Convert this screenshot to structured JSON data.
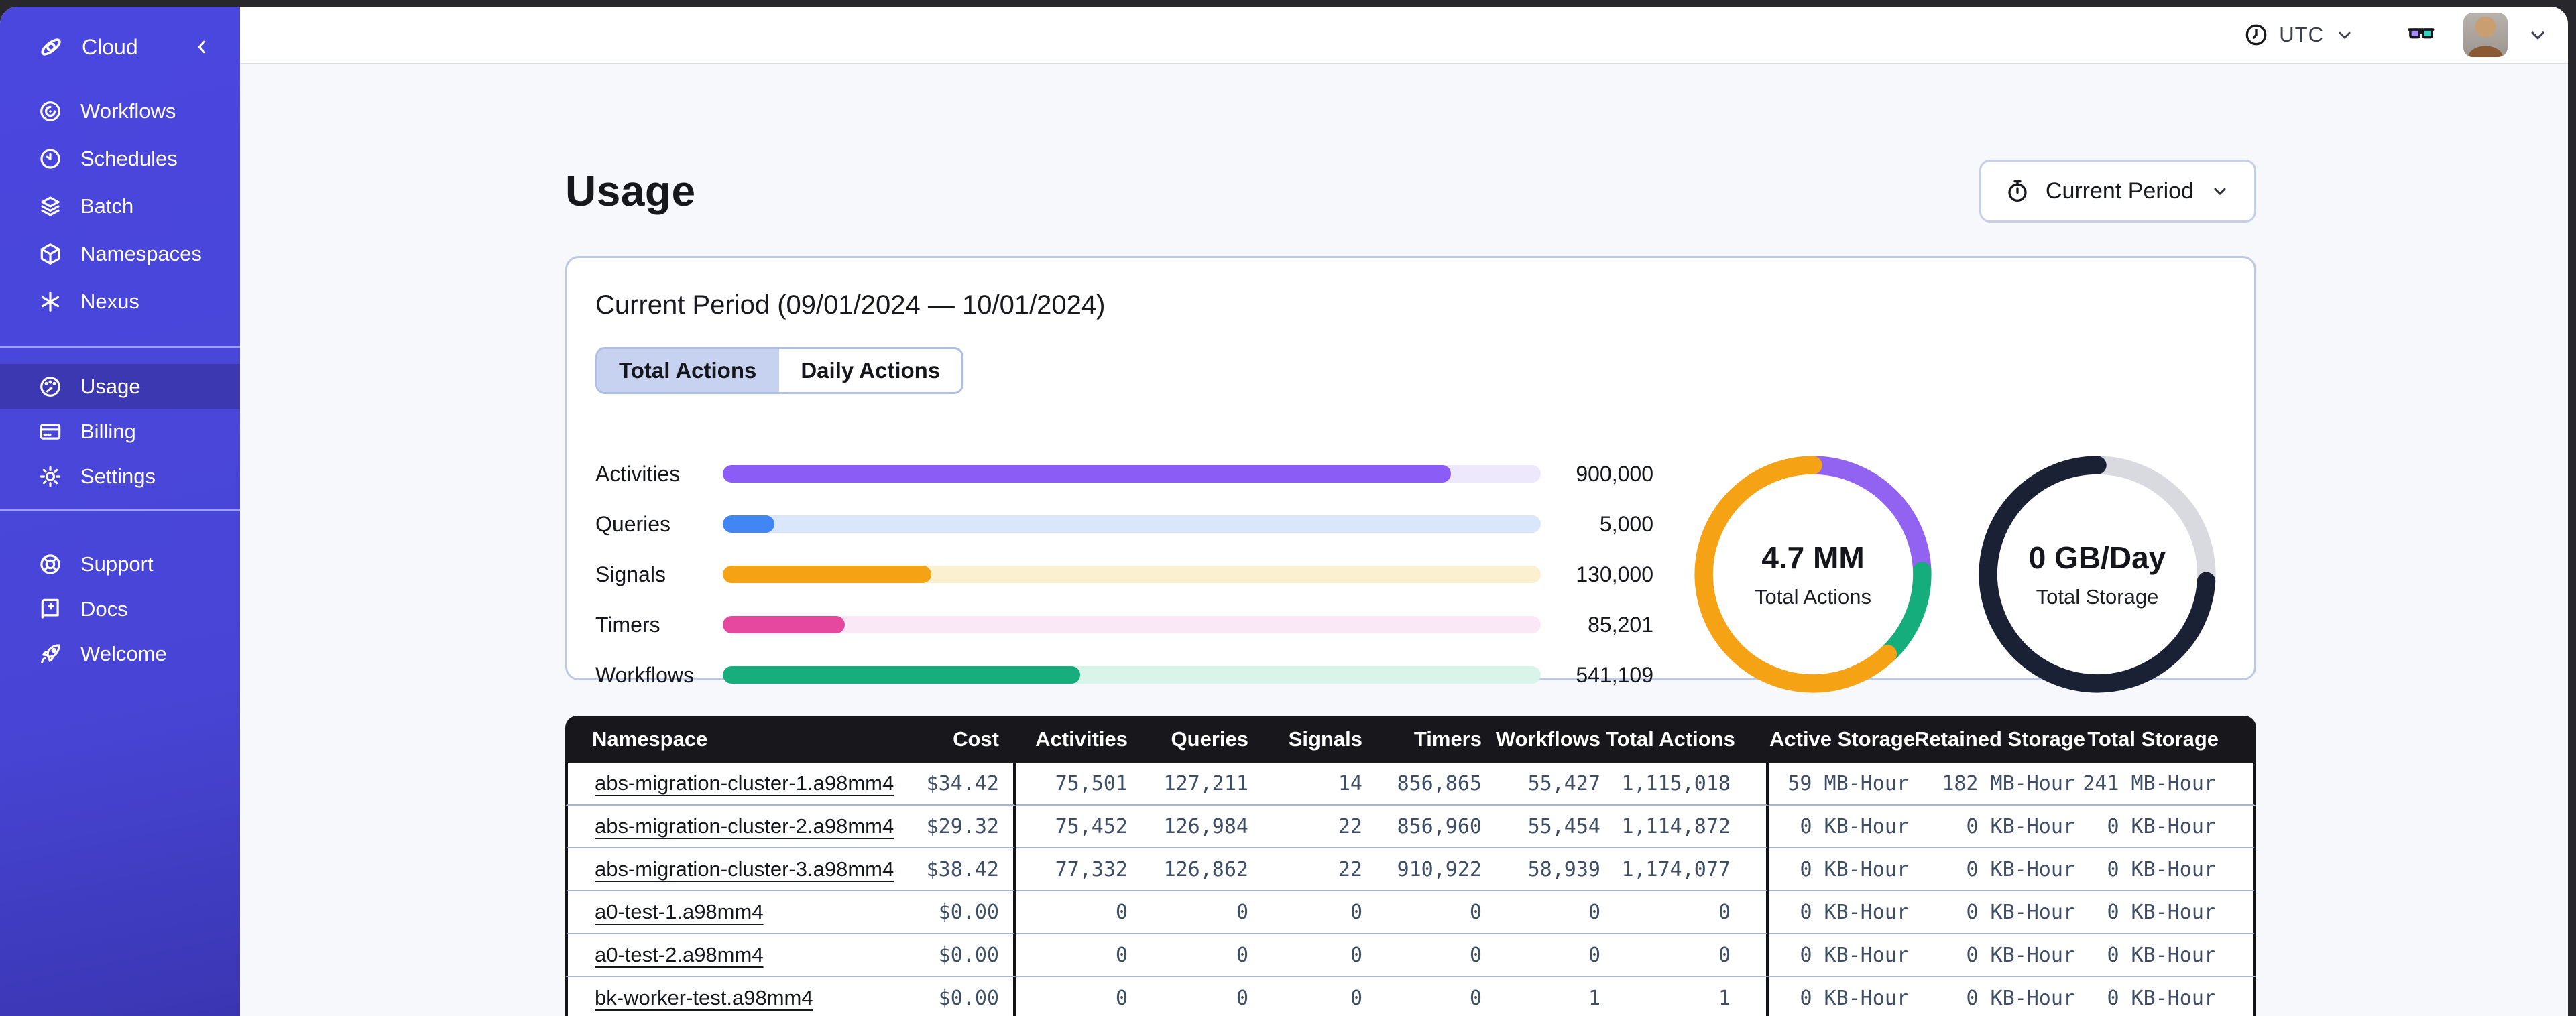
{
  "topbar": {
    "timezone": "UTC"
  },
  "sidebar": {
    "brand": {
      "label": "Cloud",
      "icon": "temporal-logo"
    },
    "items_main": [
      {
        "label": "Workflows",
        "icon": "workflows-icon"
      },
      {
        "label": "Schedules",
        "icon": "schedules-icon"
      },
      {
        "label": "Batch",
        "icon": "batch-layers-icon"
      },
      {
        "label": "Namespaces",
        "icon": "namespaces-cube-icon"
      },
      {
        "label": "Nexus",
        "icon": "nexus-asterisk-icon"
      }
    ],
    "items_account": [
      {
        "label": "Usage",
        "icon": "usage-gauge-icon",
        "active": true
      },
      {
        "label": "Billing",
        "icon": "billing-card-icon",
        "active": false
      },
      {
        "label": "Settings",
        "icon": "settings-gear-icon",
        "active": false
      }
    ],
    "items_help": [
      {
        "label": "Support",
        "icon": "support-lifering-icon"
      },
      {
        "label": "Docs",
        "icon": "docs-book-icon"
      },
      {
        "label": "Welcome",
        "icon": "welcome-rocket-icon"
      }
    ]
  },
  "page": {
    "title": "Usage",
    "period_selector_label": "Current Period"
  },
  "usage_card": {
    "title": "Current Period (09/01/2024 — 10/01/2024)",
    "tabs": [
      {
        "label": "Total Actions",
        "active": true
      },
      {
        "label": "Daily Actions",
        "active": false
      }
    ]
  },
  "chart_data": [
    {
      "type": "bar",
      "orientation": "horizontal",
      "title": "Current period usage by action type",
      "categories": [
        "Activities",
        "Queries",
        "Signals",
        "Timers",
        "Workflows"
      ],
      "values": [
        900000,
        5000,
        130000,
        85201,
        541109
      ],
      "value_labels": [
        "900,000",
        "5,000",
        "130,000",
        "85,201",
        "541,109"
      ],
      "fill_percent": [
        89,
        6.3,
        25.5,
        14.9,
        43.7
      ],
      "colors": [
        "#8b5cf6",
        "#4285f4",
        "#f5a214",
        "#e5489e",
        "#17ad7c"
      ],
      "track_colors": [
        "#ede8fc",
        "#d9e6fc",
        "#fbf0d0",
        "#fbe8f6",
        "#d9f5e9"
      ],
      "grid": false,
      "legend": "none"
    },
    {
      "type": "donut",
      "center_value": "4.7 MM",
      "center_label": "Total Actions",
      "start": "top",
      "direction": "clockwise",
      "segments": [
        {
          "name": "purple-segment",
          "percent": 24.5,
          "color": "#9263f0"
        },
        {
          "name": "green-segment",
          "percent": 13.5,
          "color": "#16ad7c"
        },
        {
          "name": "orange-segment",
          "percent": 62.0,
          "color": "#f5a214"
        }
      ]
    },
    {
      "type": "donut",
      "center_value": "0 GB/Day",
      "center_label": "Total Storage",
      "start": "top",
      "direction": "clockwise",
      "segments": [
        {
          "name": "light-gray-segment",
          "percent": 26.0,
          "color": "#d8dadf"
        },
        {
          "name": "dark-navy-segment",
          "percent": 74.0,
          "color": "#1a2134"
        }
      ]
    }
  ],
  "table": {
    "columns": [
      "Namespace",
      "Cost",
      "Activities",
      "Queries",
      "Signals",
      "Timers",
      "Workflows",
      "Total Actions",
      "Active Storage",
      "Retained Storage",
      "Total Storage"
    ],
    "rows": [
      [
        "abs-migration-cluster-1.a98mm4",
        "$34.42",
        "75,501",
        "127,211",
        "14",
        "856,865",
        "55,427",
        "1,115,018",
        "59 MB-Hour",
        "182 MB-Hour",
        "241 MB-Hour"
      ],
      [
        "abs-migration-cluster-2.a98mm4",
        "$29.32",
        "75,452",
        "126,984",
        "22",
        "856,960",
        "55,454",
        "1,114,872",
        "0 KB-Hour",
        "0 KB-Hour",
        "0 KB-Hour"
      ],
      [
        "abs-migration-cluster-3.a98mm4",
        "$38.42",
        "77,332",
        "126,862",
        "22",
        "910,922",
        "58,939",
        "1,174,077",
        "0 KB-Hour",
        "0 KB-Hour",
        "0 KB-Hour"
      ],
      [
        "a0-test-1.a98mm4",
        "$0.00",
        "0",
        "0",
        "0",
        "0",
        "0",
        "0",
        "0 KB-Hour",
        "0 KB-Hour",
        "0 KB-Hour"
      ],
      [
        "a0-test-2.a98mm4",
        "$0.00",
        "0",
        "0",
        "0",
        "0",
        "0",
        "0",
        "0 KB-Hour",
        "0 KB-Hour",
        "0 KB-Hour"
      ],
      [
        "bk-worker-test.a98mm4",
        "$0.00",
        "0",
        "0",
        "0",
        "0",
        "1",
        "1",
        "0 KB-Hour",
        "0 KB-Hour",
        "0 KB-Hour"
      ]
    ]
  },
  "colors": {
    "sidebar": "#4845d6",
    "sidebar_active_item": "#3b38b2",
    "table_header": "#17171c",
    "card_border": "#bcc8e6",
    "page_background": "#f7f8fb",
    "glasses_left_lens": "#a78bfa",
    "glasses_right_lens": "#34d3c0"
  }
}
